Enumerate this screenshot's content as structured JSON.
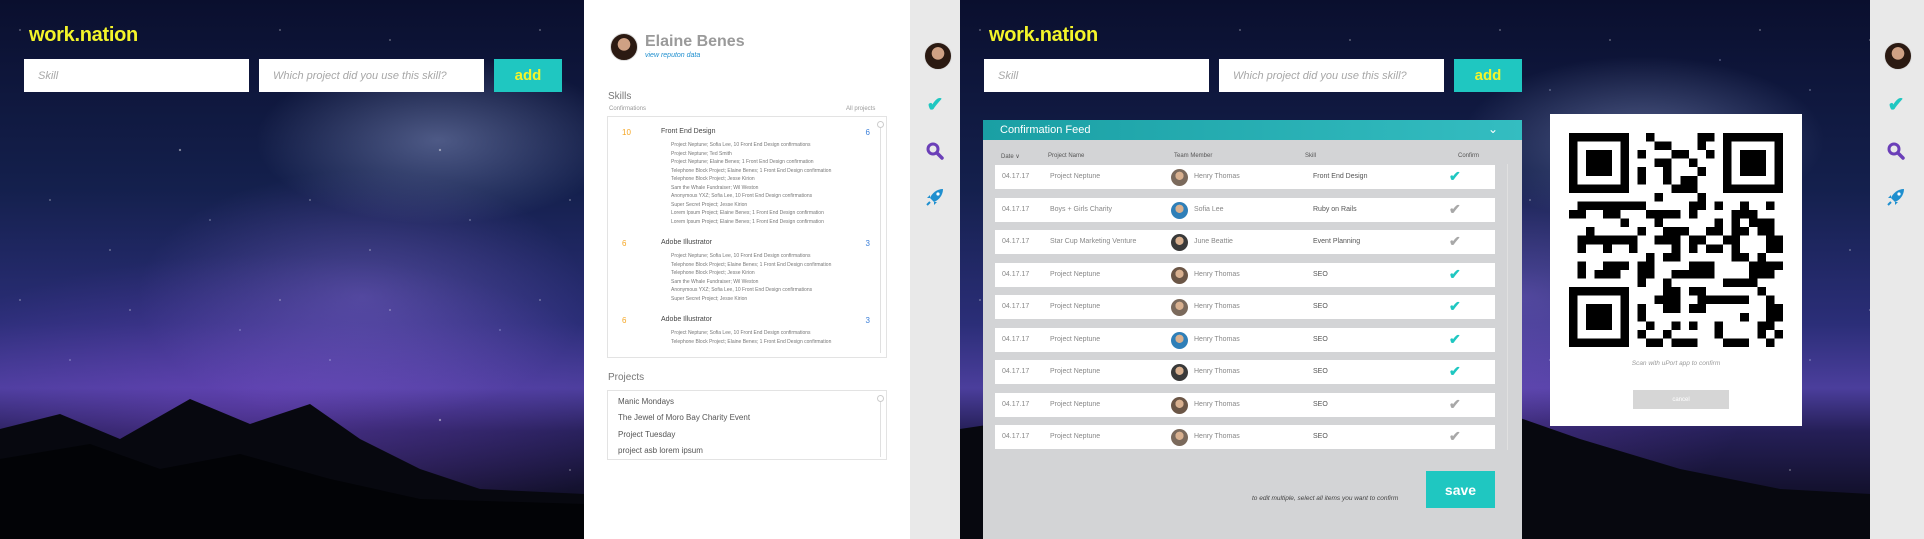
{
  "left_header": {
    "logo": "work.nation",
    "skill_placeholder": "Skill",
    "project_placeholder": "Which project did you use this skill?",
    "add_label": "add"
  },
  "right_header": {
    "logo": "work.nation",
    "skill_placeholder": "Skill",
    "project_placeholder": "Which project did you use this skill?",
    "add_label": "add"
  },
  "profile": {
    "name": "Elaine Benes",
    "link": "view reputon data",
    "skills_title": "Skills",
    "confirmations_label": "Confirmations",
    "projects_label": "All projects",
    "skills": [
      {
        "count": "10",
        "name": "Front End Design",
        "projects": "6",
        "lines": [
          "Project Neptune; Sofia Lee, 10 Front End Design confirmations",
          "Project Neptune; Ted Smith",
          "Project Neptune; Elaine Benes; 1 Front End Design confirmation",
          "Telephone Block Project; Elaine Benes; 1 Front End Design confirmation",
          "Telephone Block Project; Jesse Kirion",
          "Sam the Whale Fundraiser; Wil Weston",
          "Anonymous YXZ; Sofia Lee, 10 Front End Design confirmations",
          "Super Secret Project; Jesse Kirion",
          "Lorem Ipsum Project; Elaine Benes; 1 Front End Design confirmation",
          "Lorem Ipsum Project; Elaine Benes; 1 Front End Design confirmation"
        ]
      },
      {
        "count": "6",
        "name": "Adobe Illustrator",
        "projects": "3",
        "lines": [
          "Project Neptune; Sofia Lee, 10 Front End Design confirmations",
          "Telephone Block Project; Elaine Benes; 1 Front End Design confirmation",
          "Telephone Block Project; Jesse Kirion",
          "Sam the Whale Fundraiser; Wil Weston",
          "Anonymous YXZ; Sofia Lee, 10 Front End Design confirmations",
          "Super Secret Project; Jesse Kirion"
        ]
      },
      {
        "count": "6",
        "name": "Adobe Illustrator",
        "projects": "3",
        "lines": [
          "Project Neptune; Sofia Lee, 10 Front End Design confirmations",
          "Telephone Block Project; Elaine Benes; 1 Front End Design confirmation"
        ]
      }
    ],
    "projects_title": "Projects",
    "projects": [
      "Manic Mondays",
      "The Jewel of Moro Bay Charity Event",
      "Project Tuesday",
      "project asb lorem ipsum"
    ]
  },
  "side_icons": [
    "avatar-icon",
    "check-icon",
    "search-icon",
    "rocket-icon"
  ],
  "colors": {
    "accent": "#1fc7c1",
    "logo": "#f4f42a",
    "check_on": "#1fc7c1",
    "check_off": "#a8a8a8",
    "search": "#6b3fb8",
    "rocket": "#1f8fcf"
  },
  "feed": {
    "title": "Confirmation Feed",
    "columns": {
      "date": "Date ∨",
      "project": "Project Name",
      "member": "Team Member",
      "skill": "Skill",
      "confirm": "Confirm"
    },
    "rows": [
      {
        "date": "04.17.17",
        "project": "Project Neptune",
        "member": "Henry Thomas",
        "skill": "Front End Design",
        "confirmed": true
      },
      {
        "date": "04.17.17",
        "project": "Boys + Girls Charity",
        "member": "Sofia Lee",
        "skill": "Ruby on Rails",
        "confirmed": false
      },
      {
        "date": "04.17.17",
        "project": "Star Cup Marketing Venture",
        "member": "June Beattie",
        "skill": "Event Planning",
        "confirmed": false
      },
      {
        "date": "04.17.17",
        "project": "Project Neptune",
        "member": "Henry Thomas",
        "skill": "SEO",
        "confirmed": true
      },
      {
        "date": "04.17.17",
        "project": "Project Neptune",
        "member": "Henry Thomas",
        "skill": "SEO",
        "confirmed": true
      },
      {
        "date": "04.17.17",
        "project": "Project Neptune",
        "member": "Henry Thomas",
        "skill": "SEO",
        "confirmed": true
      },
      {
        "date": "04.17.17",
        "project": "Project Neptune",
        "member": "Henry Thomas",
        "skill": "SEO",
        "confirmed": true
      },
      {
        "date": "04.17.17",
        "project": "Project Neptune",
        "member": "Henry Thomas",
        "skill": "SEO",
        "confirmed": false
      },
      {
        "date": "04.17.17",
        "project": "Project Neptune",
        "member": "Henry Thomas",
        "skill": "SEO",
        "confirmed": false
      }
    ],
    "hint": "to edit multiple, select all items you want to confirm",
    "save_label": "save"
  },
  "qr": {
    "caption": "Scan with uPort app to confirm",
    "cancel_label": "cancel"
  }
}
